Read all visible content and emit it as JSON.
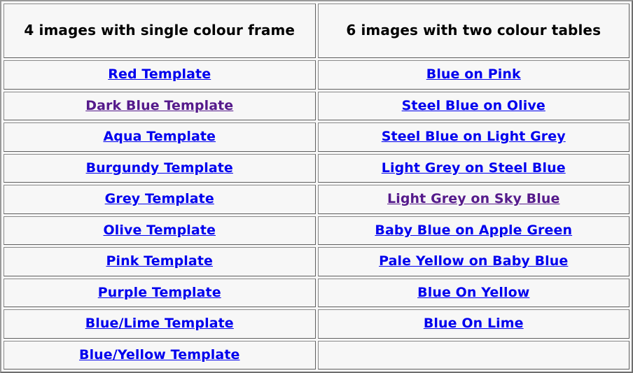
{
  "page": {
    "background_color": "#f7f7f7",
    "link_color_unvisited": "#0000ee",
    "link_color_visited": "#551a8b",
    "border_color": "#6e6e6e"
  },
  "table": {
    "headers": [
      {
        "label": "4 images with single colour frame"
      },
      {
        "label": "6 images with two colour tables"
      }
    ],
    "rows": [
      {
        "left": {
          "label": "Red Template",
          "state": "unvisited",
          "empty": false
        },
        "right": {
          "label": "Blue on Pink",
          "state": "unvisited",
          "empty": false
        }
      },
      {
        "left": {
          "label": "Dark Blue Template",
          "state": "visited",
          "empty": false
        },
        "right": {
          "label": "Steel Blue on Olive",
          "state": "unvisited",
          "empty": false
        }
      },
      {
        "left": {
          "label": "Aqua Template",
          "state": "unvisited",
          "empty": false
        },
        "right": {
          "label": "Steel Blue on Light Grey",
          "state": "unvisited",
          "empty": false
        }
      },
      {
        "left": {
          "label": "Burgundy Template",
          "state": "unvisited",
          "empty": false
        },
        "right": {
          "label": "Light Grey on Steel Blue",
          "state": "unvisited",
          "empty": false
        }
      },
      {
        "left": {
          "label": "Grey Template",
          "state": "unvisited",
          "empty": false
        },
        "right": {
          "label": "Light Grey on Sky Blue",
          "state": "visited",
          "empty": false
        }
      },
      {
        "left": {
          "label": "Olive Template",
          "state": "unvisited",
          "empty": false
        },
        "right": {
          "label": "Baby Blue on Apple Green",
          "state": "unvisited",
          "empty": false
        }
      },
      {
        "left": {
          "label": "Pink Template",
          "state": "unvisited",
          "empty": false
        },
        "right": {
          "label": "Pale Yellow on Baby Blue",
          "state": "unvisited",
          "empty": false
        }
      },
      {
        "left": {
          "label": "Purple Template",
          "state": "unvisited",
          "empty": false
        },
        "right": {
          "label": "Blue On Yellow",
          "state": "unvisited",
          "empty": false
        }
      },
      {
        "left": {
          "label": "Blue/Lime Template",
          "state": "unvisited",
          "empty": false
        },
        "right": {
          "label": "Blue On Lime",
          "state": "unvisited",
          "empty": false
        }
      },
      {
        "left": {
          "label": "Blue/Yellow Template",
          "state": "unvisited",
          "empty": false
        },
        "right": {
          "label": "",
          "state": "none",
          "empty": true
        }
      }
    ]
  }
}
